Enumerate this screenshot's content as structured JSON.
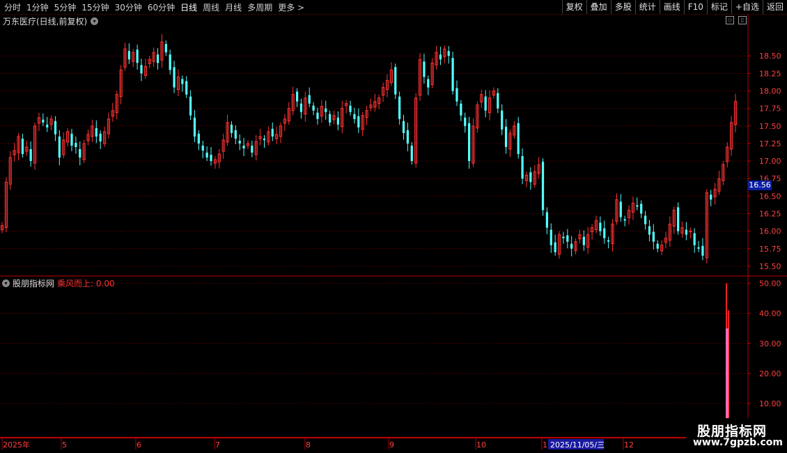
{
  "toolbar": {
    "periods": [
      "分时",
      "1分钟",
      "5分钟",
      "15分钟",
      "30分钟",
      "60分钟",
      "日线",
      "周线",
      "月线",
      "多周期",
      "更多 >"
    ],
    "active_period": "日线",
    "right_buttons": [
      "复权",
      "叠加",
      "多股",
      "统计",
      "画线",
      "F10",
      "标记",
      "+自选",
      "返回"
    ]
  },
  "main_chart": {
    "title": "万东医疗(日线,前复权)",
    "price_ticks": [
      "18.50",
      "18.25",
      "18.00",
      "17.75",
      "17.50",
      "17.25",
      "17.00",
      "16.75",
      "16.50",
      "16.25",
      "16.00",
      "15.75",
      "15.50"
    ],
    "current_price": "16.56"
  },
  "indicator": {
    "name": "股朋指标网",
    "signal_label": "乘风而上: 0.00",
    "ticks": [
      "50.00",
      "40.00",
      "30.00",
      "20.00",
      "10.00"
    ]
  },
  "date_axis": {
    "labels": [
      "2025年",
      "5",
      "6",
      "7",
      "8",
      "9",
      "10",
      "1",
      "12"
    ],
    "cursor_date": "2025/11/05/三"
  },
  "watermark": {
    "title": "股朋指标网",
    "url": "www.7gpzb.com"
  },
  "colors": {
    "up": "#ff3232",
    "down": "#54ffff",
    "grid": "#8b0000",
    "axis": "#c00000",
    "signal": "#ff69b4"
  },
  "chart_data": {
    "type": "candlestick",
    "price_ylim": [
      15.4,
      18.9
    ],
    "indicator_ylim": [
      0,
      52
    ],
    "closes": [
      16.08,
      16.7,
      17.05,
      17.15,
      17.35,
      17.1,
      17.2,
      17.0,
      17.5,
      17.62,
      17.55,
      17.48,
      17.6,
      17.38,
      17.05,
      17.3,
      17.42,
      17.22,
      17.2,
      17.05,
      17.25,
      17.38,
      17.5,
      17.35,
      17.28,
      17.42,
      17.6,
      17.72,
      17.95,
      18.3,
      18.6,
      18.45,
      18.55,
      18.4,
      18.25,
      18.35,
      18.45,
      18.55,
      18.4,
      18.7,
      18.55,
      18.3,
      18.05,
      18.2,
      18.1,
      17.95,
      17.65,
      17.35,
      17.25,
      17.15,
      17.05,
      17.0,
      17.02,
      17.1,
      17.3,
      17.55,
      17.4,
      17.32,
      17.25,
      17.18,
      17.25,
      17.12,
      17.28,
      17.35,
      17.3,
      17.42,
      17.35,
      17.38,
      17.5,
      17.6,
      17.75,
      17.95,
      17.85,
      17.7,
      17.9,
      17.82,
      17.72,
      17.6,
      17.78,
      17.7,
      17.55,
      17.65,
      17.52,
      17.75,
      17.82,
      17.7,
      17.6,
      17.48,
      17.65,
      17.72,
      17.8,
      17.85,
      17.9,
      18.05,
      18.15,
      18.3,
      17.95,
      17.6,
      17.4,
      17.25,
      17.0,
      17.9,
      18.45,
      18.2,
      18.05,
      18.4,
      18.55,
      18.45,
      18.6,
      18.5,
      18.0,
      17.85,
      17.65,
      17.5,
      17.0,
      17.5,
      17.8,
      17.95,
      17.72,
      17.9,
      18.0,
      17.75,
      17.45,
      17.2,
      17.4,
      17.5,
      17.1,
      16.75,
      16.8,
      16.7,
      16.85,
      16.95,
      16.3,
      16.05,
      15.8,
      15.7,
      15.95,
      15.9,
      15.85,
      15.75,
      15.85,
      15.95,
      15.8,
      15.95,
      16.05,
      16.15,
      16.0,
      15.9,
      15.85,
      16.1,
      16.45,
      16.2,
      16.15,
      16.3,
      16.4,
      16.35,
      16.25,
      16.1,
      15.95,
      15.85,
      15.75,
      15.8,
      15.9,
      16.1,
      16.3,
      16.0,
      16.05,
      15.95,
      16.0,
      15.8,
      15.75,
      15.65,
      16.55,
      16.45,
      16.6,
      16.75,
      16.95,
      17.2,
      17.55,
      17.85
    ]
  }
}
